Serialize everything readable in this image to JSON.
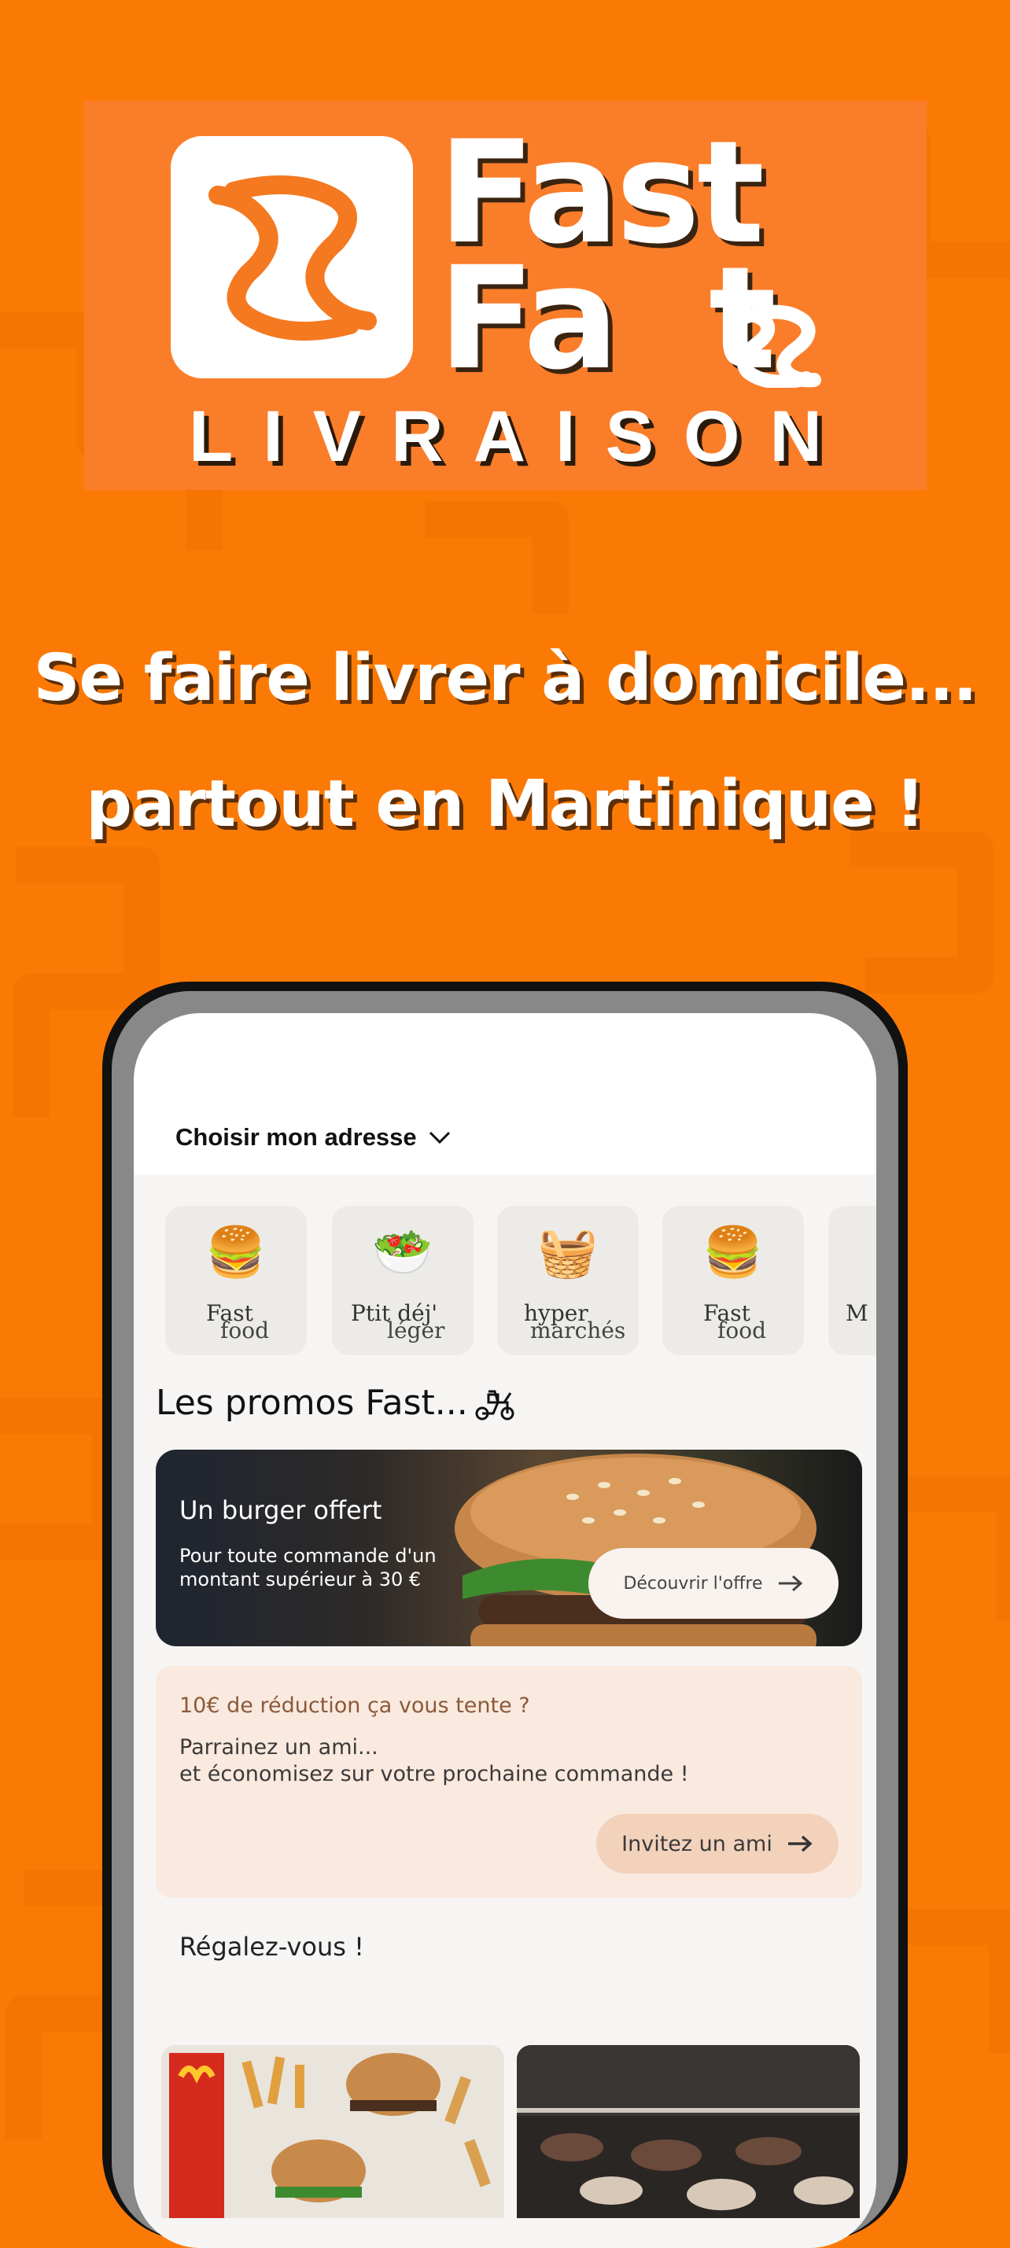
{
  "brand": {
    "line1": "Fast",
    "line2": "Fa",
    "line2_end": "t",
    "subtitle": "LIVRAISON"
  },
  "tagline": {
    "line1": "Se faire livrer à domicile...",
    "line2": "partout en Martinique !"
  },
  "app": {
    "address_label": "Choisir mon adresse",
    "categories": [
      {
        "line1": "Fast",
        "line2": "food",
        "icon": "burger-icon"
      },
      {
        "line1": "Ptit déj'",
        "line2": "léger",
        "icon": "breakfast-bowl-icon"
      },
      {
        "line1": "hyper",
        "line2": "marchés",
        "icon": "shopping-basket-icon"
      },
      {
        "line1": "Fast",
        "line2": "food",
        "icon": "burger-icon"
      },
      {
        "line1": "M",
        "line2": "",
        "icon": ""
      }
    ],
    "promos_title": "Les promos Fast...",
    "promo": {
      "title": "Un burger offert",
      "description": "Pour toute commande d'un montant supérieur à 30 €",
      "button": "Découvrir l'offre"
    },
    "referral": {
      "title": "10€ de réduction ça vous tente ?",
      "line1": "Parrainez un ami...",
      "line2": "et économisez sur votre prochaine commande !",
      "button": "Invitez un ami"
    },
    "section_title": "Régalez-vous !"
  },
  "colors": {
    "background": "#FB7A06",
    "logo_panel": "#FA7D2A",
    "referral_bg": "#FAE9DE",
    "referral_button": "#F3D2BC"
  }
}
